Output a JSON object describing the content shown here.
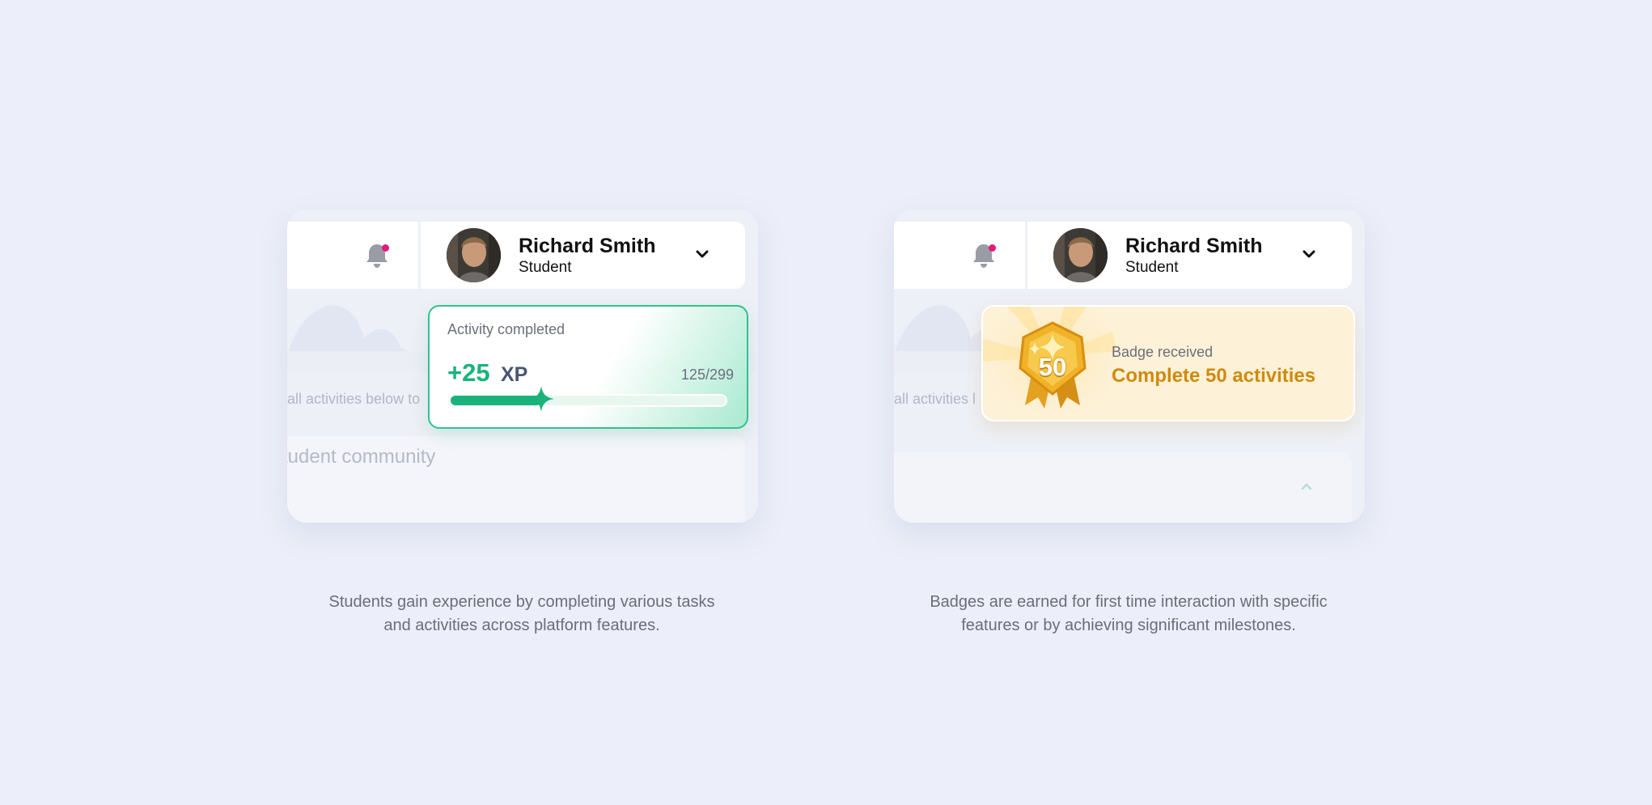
{
  "colors": {
    "background": "#eceff9",
    "xp_accent": "#19b37b",
    "badge_accent": "#cf8a0c",
    "notification_dot": "#e5197a"
  },
  "user": {
    "name": "Richard Smith",
    "role": "Student",
    "avatar_icon": "user-photo-avatar"
  },
  "left_panel": {
    "faded_text": "all activities below to",
    "faded_title": "tudent community",
    "xp_popup": {
      "title": "Activity completed",
      "value": "+25",
      "unit": "XP",
      "current": 125,
      "total": 299,
      "progress_label": "125/299",
      "progress_fraction": 0.3,
      "icon": "sparkle-icon"
    },
    "caption_line1": "Students gain experience by completing various tasks",
    "caption_line2": "and activities across platform features."
  },
  "right_panel": {
    "faded_text": "all activities l",
    "badge_popup": {
      "label": "Badge received",
      "title": "Complete 50 activities",
      "medal_number": "50",
      "icon": "medal-badge-icon"
    },
    "caption_line1": "Badges are earned for first time interaction with specific",
    "caption_line2": "features or by achieving significant milestones."
  }
}
